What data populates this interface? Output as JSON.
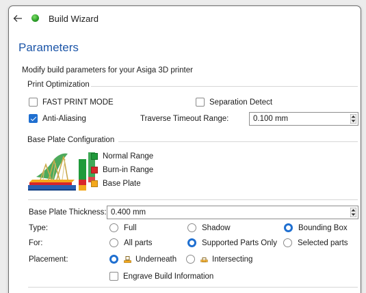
{
  "window": {
    "title": "Build Wizard",
    "heading": "Parameters",
    "subtitle": "Modify build parameters for your Asiga 3D printer"
  },
  "print_optimization": {
    "title": "Print Optimization",
    "fast_print": {
      "label": "FAST PRINT MODE",
      "checked": false
    },
    "separation_detect": {
      "label": "Separation Detect",
      "checked": false
    },
    "anti_aliasing": {
      "label": "Anti-Aliasing",
      "checked": true
    },
    "traverse_timeout": {
      "label": "Traverse Timeout Range:",
      "value": "0.100 mm"
    }
  },
  "base_plate": {
    "title": "Base Plate Configuration",
    "legend": [
      {
        "label": "Normal Range",
        "color": "#1f9a3a"
      },
      {
        "label": "Burn-in Range",
        "color": "#d8262a"
      },
      {
        "label": "Base Plate",
        "color": "#f4a81c"
      }
    ],
    "thickness": {
      "label": "Base Plate Thickness:",
      "value": "0.400 mm"
    },
    "type": {
      "label": "Type:",
      "options": [
        "Full",
        "Shadow",
        "Bounding Box"
      ],
      "selected": "Bounding Box"
    },
    "for": {
      "label": "For:",
      "options": [
        "All parts",
        "Supported Parts Only",
        "Selected parts"
      ],
      "selected": "Supported Parts Only"
    },
    "placement": {
      "label": "Placement:",
      "options": [
        "Underneath",
        "Intersecting"
      ],
      "selected": "Underneath"
    },
    "engrave": {
      "label": "Engrave Build Information",
      "checked": false
    }
  },
  "colors": {
    "accent": "#1f6fd0",
    "heading": "#1d56a8"
  }
}
